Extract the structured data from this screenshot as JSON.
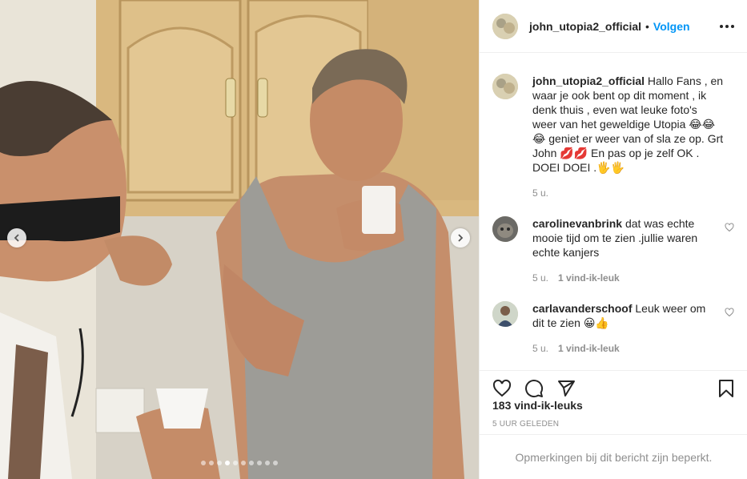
{
  "post": {
    "author": "john_utopia2_official",
    "separator": "•",
    "follow_label": "Volgen",
    "more_icon": "more-options-icon"
  },
  "media": {
    "carousel_count": 10,
    "active_index": 3,
    "prev_icon": "chevron-left-icon",
    "next_icon": "chevron-right-icon"
  },
  "comments": [
    {
      "user": "john_utopia2_official",
      "text": "Hallo Fans , en waar je ook bent op dit moment , ik denk thuis , even wat leuke foto's weer van het geweldige Utopia 😂😂😂 geniet er weer van of sla ze op. Grt John 💋💋 En pas op je zelf OK . DOEI DOEI .🖐🖐",
      "time": "5 u."
    },
    {
      "user": "carolinevanbrink",
      "text": "dat was echte mooie tijd om te zien .jullie waren echte kanjers",
      "time": "5 u.",
      "likes": "1 vind-ik-leuk"
    },
    {
      "user": "carlavanderschoof",
      "text": "Leuk weer om dit te zien 😀👍",
      "time": "5 u.",
      "likes": "1 vind-ik-leuk"
    }
  ],
  "actions": {
    "like_icon": "heart-icon",
    "comment_icon": "comment-icon",
    "share_icon": "share-icon",
    "save_icon": "bookmark-icon"
  },
  "likes_count": "183 vind-ik-leuks",
  "posted_ago": "5 UUR GELEDEN",
  "comments_restricted": "Opmerkingen bij dit bericht zijn beperkt.",
  "colors": {
    "accent": "#0095f6",
    "text": "#262626",
    "muted": "#8e8e8e",
    "border": "#efefef"
  }
}
